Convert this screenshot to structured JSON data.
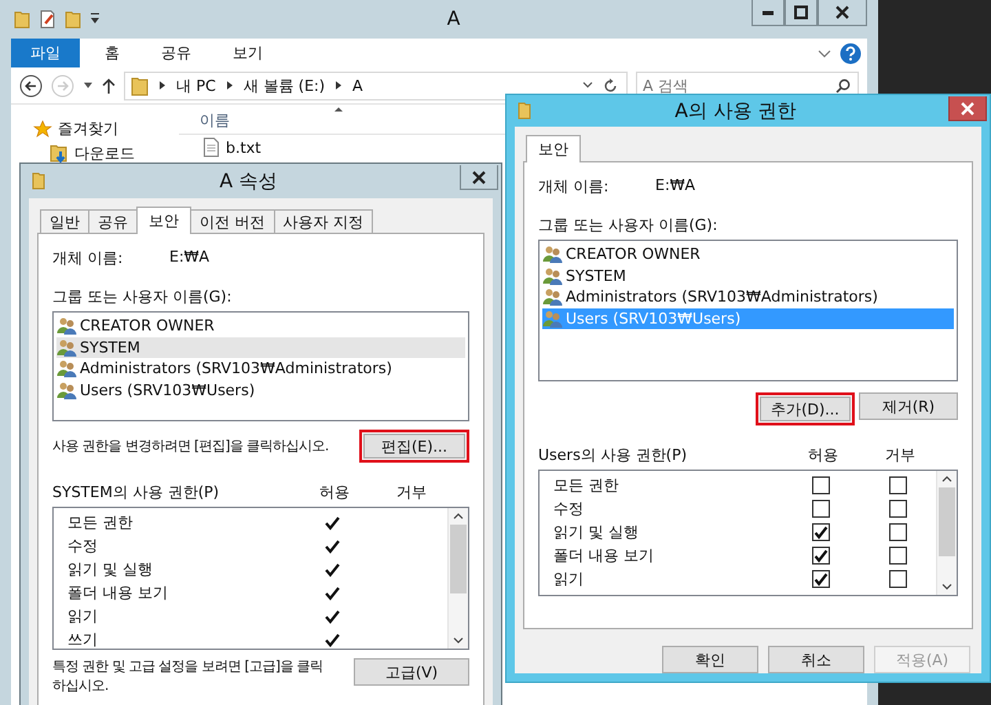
{
  "explorer": {
    "title": "A",
    "ribbon_tabs": [
      {
        "label": "파일",
        "selected": true
      },
      {
        "label": "홈",
        "selected": false
      },
      {
        "label": "공유",
        "selected": false
      },
      {
        "label": "보기",
        "selected": false
      }
    ],
    "breadcrumbs": [
      "내 PC",
      "새 볼륨 (E:)",
      "A"
    ],
    "search": {
      "placeholder": "A 검색"
    },
    "nav_items": [
      {
        "label": "즐겨찾기",
        "kind": "favorites"
      },
      {
        "label": "다운로드",
        "kind": "downloads"
      }
    ],
    "column_header": "이름",
    "files": [
      "b.txt"
    ]
  },
  "properties_dialog": {
    "title": "A 속성",
    "active": false,
    "tabs": [
      {
        "label": "일반",
        "selected": false
      },
      {
        "label": "공유",
        "selected": false
      },
      {
        "label": "보안",
        "selected": true
      },
      {
        "label": "이전 버전",
        "selected": false
      },
      {
        "label": "사용자 지정",
        "selected": false
      }
    ],
    "object_label": "개체 이름:",
    "object_value": "E:₩A",
    "groups_label": "그룹 또는 사용자 이름(G):",
    "principals": [
      {
        "name": "CREATOR OWNER",
        "selected": false
      },
      {
        "name": "SYSTEM",
        "selected": true
      },
      {
        "name": "Administrators (SRV103₩Administrators)",
        "selected": false
      },
      {
        "name": "Users (SRV103₩Users)",
        "selected": false
      }
    ],
    "edit_hint": "사용 권한을 변경하려면 [편집]을 클릭하십시오.",
    "edit_button": {
      "label": "편집(E)...",
      "highlighted": true
    },
    "permissions_label": "SYSTEM의 사용 권한(P)",
    "allow_header": "허용",
    "deny_header": "거부",
    "permissions": [
      {
        "name": "모든 권한",
        "kind": "checkmark",
        "allow": true,
        "deny": false
      },
      {
        "name": "수정",
        "kind": "checkmark",
        "allow": true,
        "deny": false
      },
      {
        "name": "읽기 및 실행",
        "kind": "checkmark",
        "allow": true,
        "deny": false
      },
      {
        "name": "폴더 내용 보기",
        "kind": "checkmark",
        "allow": true,
        "deny": false
      },
      {
        "name": "읽기",
        "kind": "checkmark",
        "allow": true,
        "deny": false
      },
      {
        "name": "쓰기",
        "kind": "checkmark",
        "allow": true,
        "deny": false
      }
    ],
    "advanced_hint": "특정 권한 및 고급 설정을 보려면 [고급]을 클릭하십시오.",
    "advanced_button": "고급(V)"
  },
  "permissions_dialog": {
    "title": "A의 사용 권한",
    "active": true,
    "tabs": [
      {
        "label": "보안",
        "selected": true
      }
    ],
    "object_label": "개체 이름:",
    "object_value": "E:₩A",
    "groups_label": "그룹 또는 사용자 이름(G):",
    "principals": [
      {
        "name": "CREATOR OWNER",
        "selected": false
      },
      {
        "name": "SYSTEM",
        "selected": false
      },
      {
        "name": "Administrators (SRV103₩Administrators)",
        "selected": false
      },
      {
        "name": "Users (SRV103₩Users)",
        "selected": true
      }
    ],
    "list_buttons": [
      {
        "label": "추가(D)...",
        "highlighted": true
      },
      {
        "label": "제거(R)",
        "highlighted": false
      }
    ],
    "permissions_label": "Users의 사용 권한(P)",
    "allow_header": "허용",
    "deny_header": "거부",
    "permissions": [
      {
        "name": "모든 권한",
        "kind": "checkbox",
        "allow": false,
        "deny": false
      },
      {
        "name": "수정",
        "kind": "checkbox",
        "allow": false,
        "deny": false
      },
      {
        "name": "읽기 및 실행",
        "kind": "checkbox",
        "allow": true,
        "deny": false
      },
      {
        "name": "폴더 내용 보기",
        "kind": "checkbox",
        "allow": true,
        "deny": false
      },
      {
        "name": "읽기",
        "kind": "checkbox",
        "allow": true,
        "deny": false
      }
    ],
    "footer_buttons": [
      {
        "label": "확인",
        "disabled": false
      },
      {
        "label": "취소",
        "disabled": false
      },
      {
        "label": "적용(A)",
        "disabled": true
      }
    ]
  }
}
